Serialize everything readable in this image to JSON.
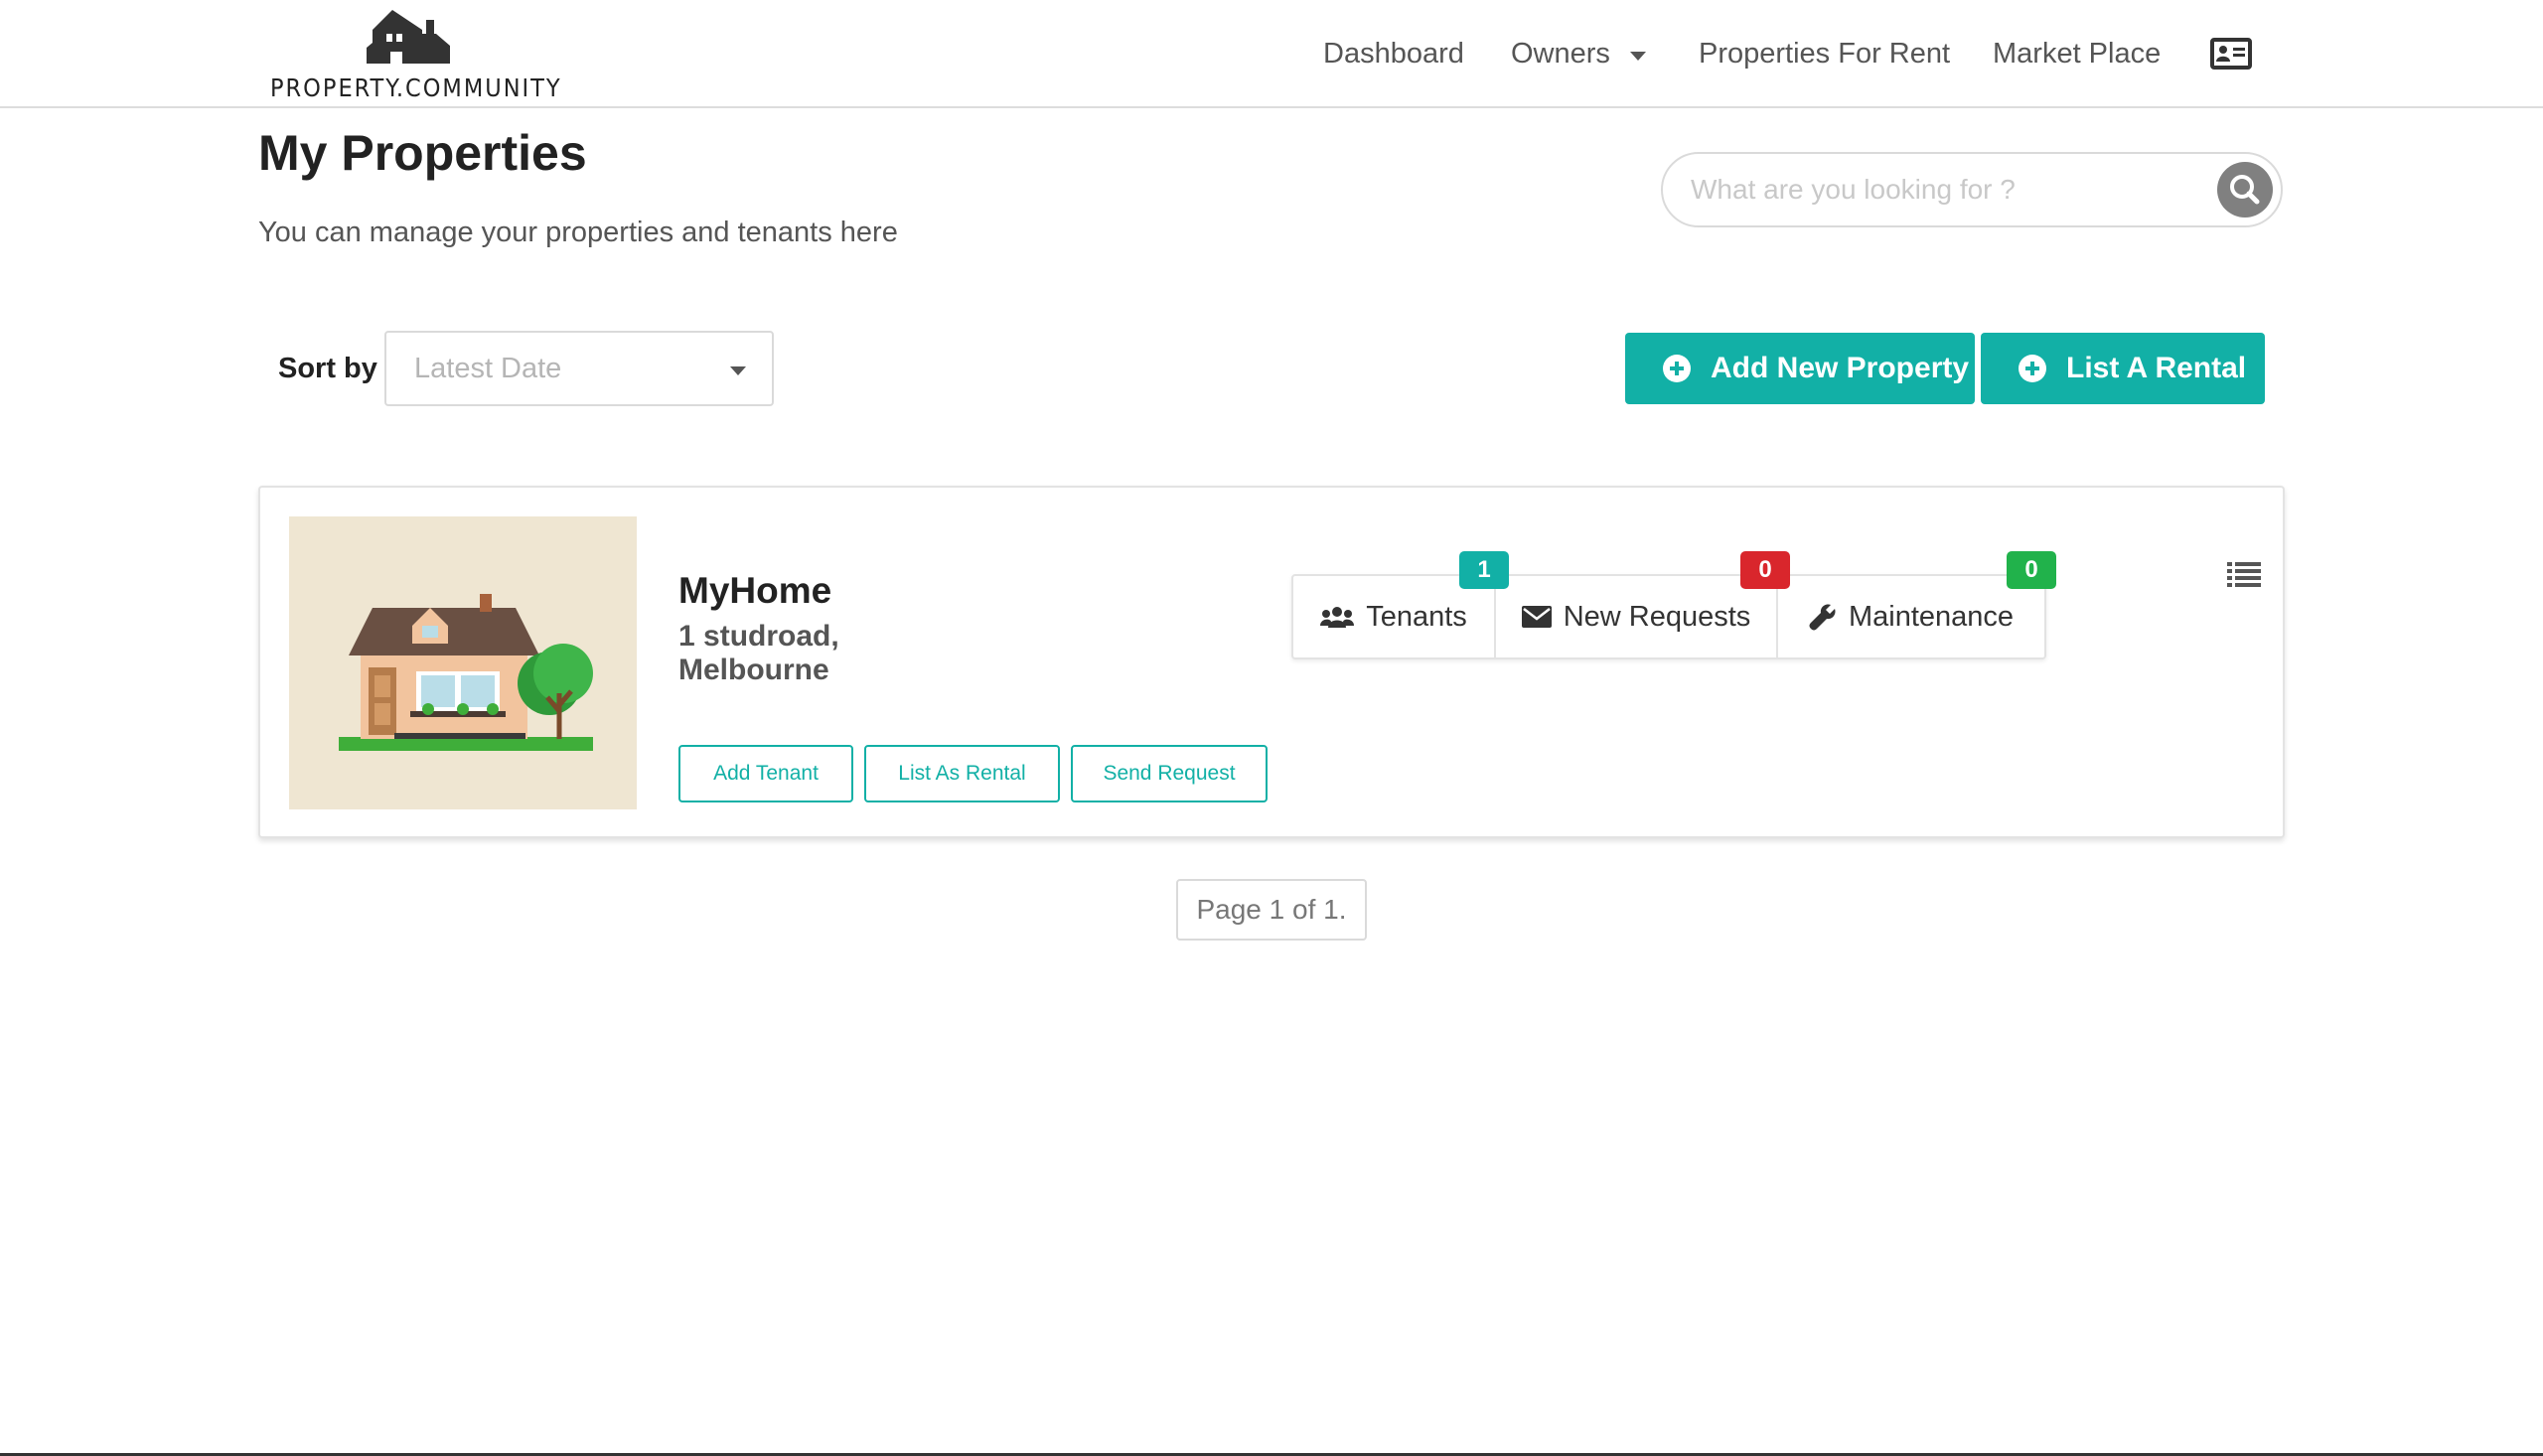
{
  "header": {
    "logo_text": "PROPERTY.COMMUNITY",
    "nav": {
      "dashboard": "Dashboard",
      "owners": "Owners",
      "properties_for_rent": "Properties For Rent",
      "market_place": "Market Place"
    },
    "icons": [
      "logo-house-icon",
      "chevron-down-icon",
      "contact-card-icon"
    ]
  },
  "page": {
    "title": "My Properties",
    "subtitle": "You can manage your properties and tenants here"
  },
  "search": {
    "placeholder": "What are you looking for ?",
    "icon": "search-icon"
  },
  "sort": {
    "label": "Sort by :",
    "selected": "Latest Date"
  },
  "actions": {
    "add_property": "Add New Property",
    "list_rental": "List A Rental"
  },
  "property": {
    "name": "MyHome",
    "address": "1 studroad, Melbourne",
    "buttons": {
      "add_tenant": "Add Tenant",
      "list_as_rental": "List As Rental",
      "send_request": "Send Request"
    },
    "stats": {
      "tenants_label": "Tenants",
      "tenants_count": "1",
      "requests_label": "New Requests",
      "requests_count": "0",
      "maintenance_label": "Maintenance",
      "maintenance_count": "0"
    }
  },
  "pagination": {
    "text": "Page 1 of 1."
  },
  "colors": {
    "accent": "#12b0a6",
    "badge_tenants": "#12b0a6",
    "badge_requests": "#d9262c",
    "badge_maintenance": "#21b24b",
    "thumbnail_bg": "#efe6d2"
  }
}
